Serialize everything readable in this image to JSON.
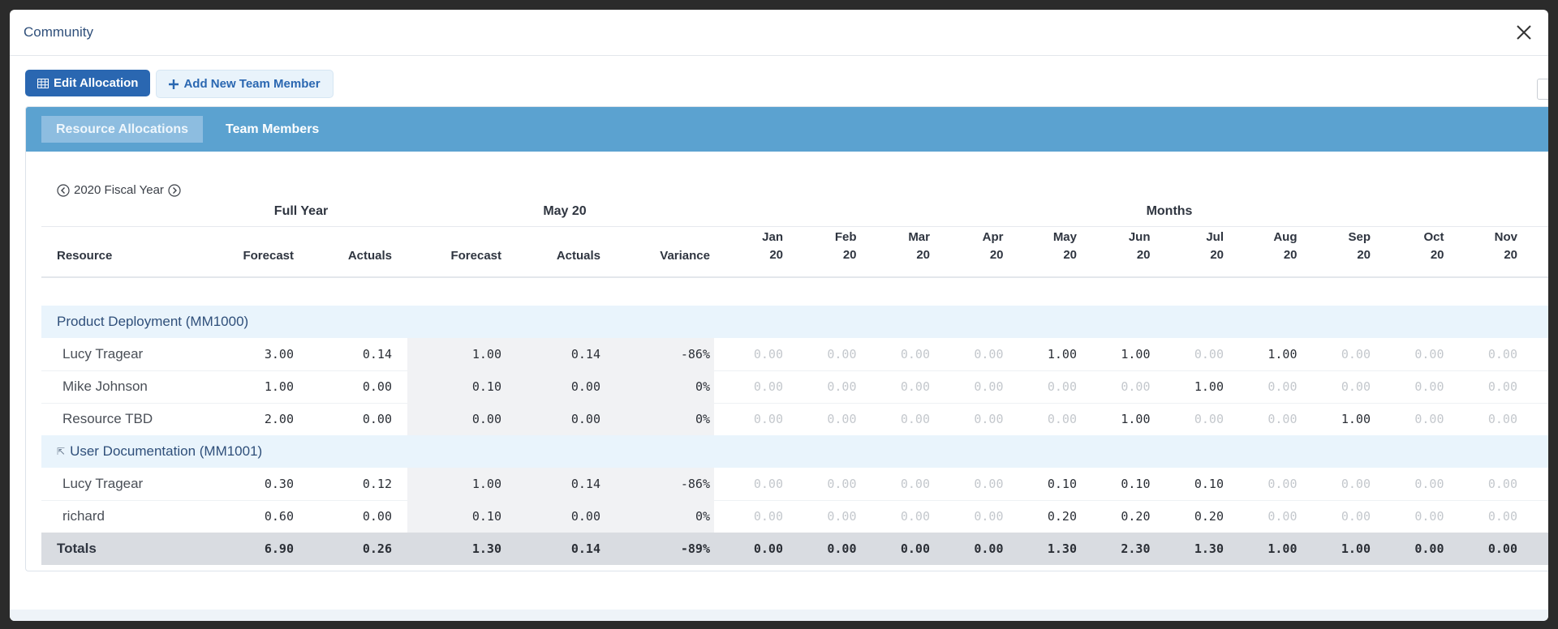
{
  "modal": {
    "title": "Community",
    "close_icon": "close-icon"
  },
  "toolbar": {
    "edit_label": "Edit Allocation",
    "edit_icon": "grid-icon",
    "add_label": "Add New Team Member",
    "add_icon": "plus-icon"
  },
  "tabs": [
    {
      "label": "Resource Allocations",
      "active": true
    },
    {
      "label": "Team Members",
      "active": false
    }
  ],
  "fiscal_year": "2020 Fiscal Year",
  "groups": {
    "full_year": "Full Year",
    "month": "May 20",
    "months": "Months"
  },
  "headers": {
    "resource": "Resource",
    "fy_forecast": "Forecast",
    "fy_actuals": "Actuals",
    "m_forecast": "Forecast",
    "m_actuals": "Actuals",
    "variance": "Variance",
    "months": [
      {
        "m": "Jan",
        "y": "20"
      },
      {
        "m": "Feb",
        "y": "20"
      },
      {
        "m": "Mar",
        "y": "20"
      },
      {
        "m": "Apr",
        "y": "20"
      },
      {
        "m": "May",
        "y": "20"
      },
      {
        "m": "Jun",
        "y": "20"
      },
      {
        "m": "Jul",
        "y": "20"
      },
      {
        "m": "Aug",
        "y": "20"
      },
      {
        "m": "Sep",
        "y": "20"
      },
      {
        "m": "Oct",
        "y": "20"
      },
      {
        "m": "Nov",
        "y": "20"
      }
    ]
  },
  "sections": [
    {
      "name": "Product Deployment (MM1000)",
      "icon": "",
      "rows": [
        {
          "name": "Lucy Tragear",
          "fy_forecast": "3.00",
          "fy_actuals": "0.14",
          "m_forecast": "1.00",
          "m_actuals": "0.14",
          "variance": "-86%",
          "months": [
            "0.00",
            "0.00",
            "0.00",
            "0.00",
            "1.00",
            "1.00",
            "0.00",
            "1.00",
            "0.00",
            "0.00",
            "0.00"
          ]
        },
        {
          "name": "Mike Johnson",
          "fy_forecast": "1.00",
          "fy_actuals": "0.00",
          "m_forecast": "0.10",
          "m_actuals": "0.00",
          "variance": "0%",
          "months": [
            "0.00",
            "0.00",
            "0.00",
            "0.00",
            "0.00",
            "0.00",
            "1.00",
            "0.00",
            "0.00",
            "0.00",
            "0.00"
          ]
        },
        {
          "name": "Resource TBD",
          "fy_forecast": "2.00",
          "fy_actuals": "0.00",
          "m_forecast": "0.00",
          "m_actuals": "0.00",
          "variance": "0%",
          "months": [
            "0.00",
            "0.00",
            "0.00",
            "0.00",
            "0.00",
            "1.00",
            "0.00",
            "0.00",
            "1.00",
            "0.00",
            "0.00"
          ]
        }
      ]
    },
    {
      "name": "User Documentation (MM1001)",
      "icon": "collapse-icon",
      "rows": [
        {
          "name": "Lucy Tragear",
          "fy_forecast": "0.30",
          "fy_actuals": "0.12",
          "m_forecast": "1.00",
          "m_actuals": "0.14",
          "variance": "-86%",
          "months": [
            "0.00",
            "0.00",
            "0.00",
            "0.00",
            "0.10",
            "0.10",
            "0.10",
            "0.00",
            "0.00",
            "0.00",
            "0.00"
          ]
        },
        {
          "name": "richard",
          "fy_forecast": "0.60",
          "fy_actuals": "0.00",
          "m_forecast": "0.10",
          "m_actuals": "0.00",
          "variance": "0%",
          "months": [
            "0.00",
            "0.00",
            "0.00",
            "0.00",
            "0.20",
            "0.20",
            "0.20",
            "0.00",
            "0.00",
            "0.00",
            "0.00"
          ]
        }
      ]
    }
  ],
  "totals": {
    "label": "Totals",
    "fy_forecast": "6.90",
    "fy_actuals": "0.26",
    "m_forecast": "1.30",
    "m_actuals": "0.14",
    "variance": "-89%",
    "months": [
      "0.00",
      "0.00",
      "0.00",
      "0.00",
      "1.30",
      "2.30",
      "1.30",
      "1.00",
      "1.00",
      "0.00",
      "0.00"
    ]
  },
  "colors": {
    "primary": "#2a67b1",
    "tabbar": "#5ba2d0",
    "section_bg": "#e9f4fc",
    "totals_bg": "#d9dce1",
    "dim_value": "#c4c8cd"
  }
}
